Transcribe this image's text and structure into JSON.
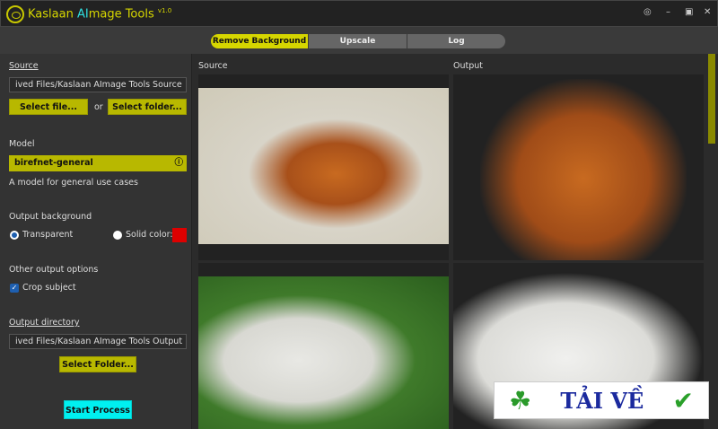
{
  "app": {
    "name_part1": "Kaslaan ",
    "name_ai": "AI",
    "name_part2": "mage Tools",
    "version": "v1.0"
  },
  "window_controls": [
    "help-icon",
    "minimize-icon",
    "maximize-icon",
    "close-icon"
  ],
  "tabs": [
    {
      "label": "Remove Background",
      "active": true
    },
    {
      "label": "Upscale"
    },
    {
      "label": "Log"
    }
  ],
  "left": {
    "source_label": "Source",
    "source_path": "ived Files/Kaslaan AImage Tools Source",
    "select_file": "Select file...",
    "or": "or",
    "select_folder": "Select folder...",
    "model_label": "Model",
    "model_value": "birefnet-general",
    "model_desc": "A model for general use cases",
    "bg_label": "Output background",
    "transparent": "Transparent",
    "solid": "Solid color:",
    "solid_color": "#dd0000",
    "other_label": "Other output options",
    "crop": "Crop subject",
    "outdir_label": "Output directory",
    "outdir_path": "ived Files/Kaslaan AImage Tools Output",
    "select_out_folder": "Select Folder...",
    "start": "Start Process"
  },
  "preview": {
    "source_label": "Source",
    "output_label": "Output"
  },
  "watermark": "TẢI VỀ"
}
